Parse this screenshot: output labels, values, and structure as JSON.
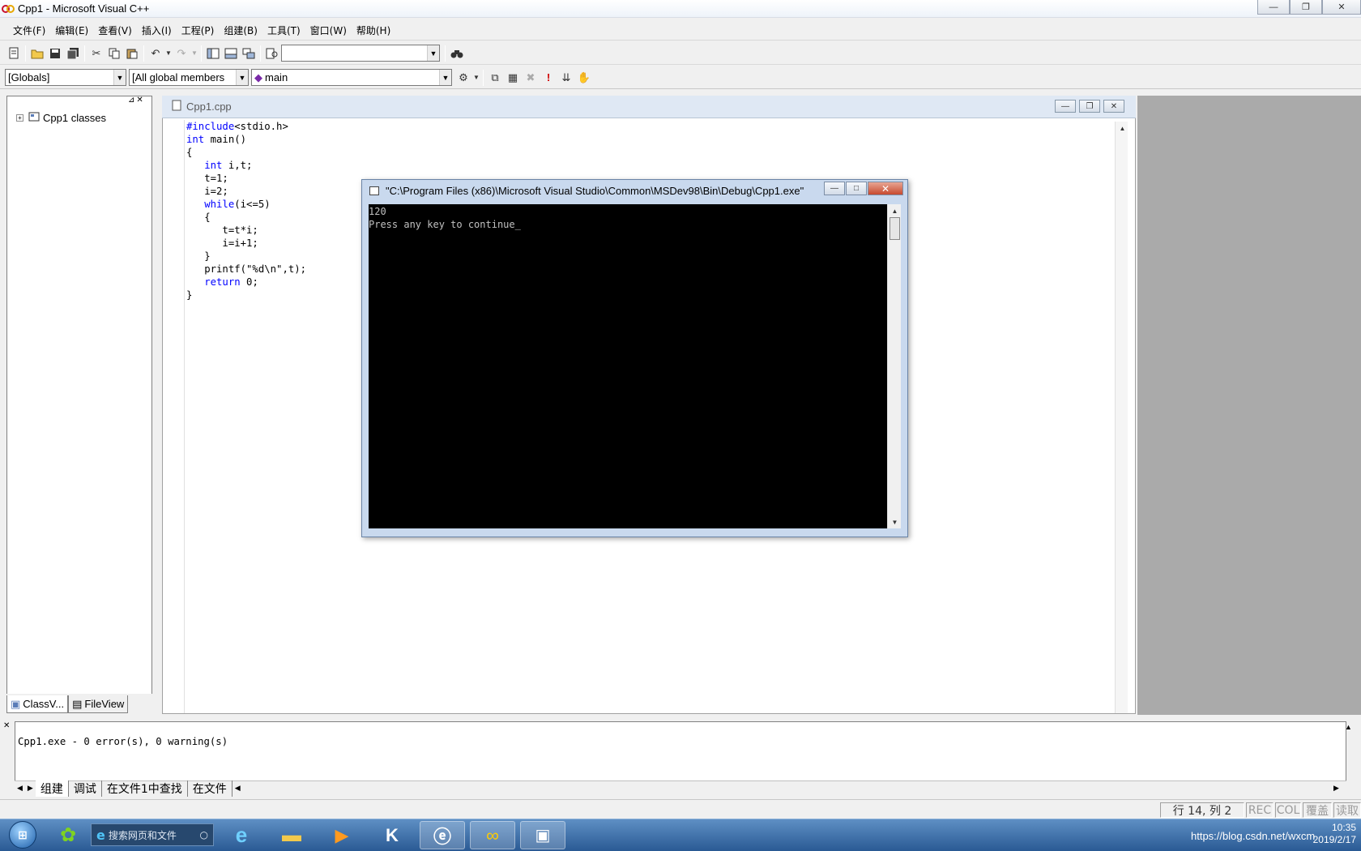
{
  "window": {
    "title": "Cpp1 - Microsoft Visual C++",
    "minimize": "—",
    "restore": "❐",
    "close": "✕"
  },
  "menu": [
    "文件(F)",
    "编辑(E)",
    "查看(V)",
    "插入(I)",
    "工程(P)",
    "组建(B)",
    "工具(T)",
    "窗口(W)",
    "帮助(H)"
  ],
  "toolbar2": {
    "scope": "[Globals]",
    "members": "[All global members",
    "function": "main"
  },
  "workspace": {
    "tree_root": "Cpp1 classes",
    "tabs": [
      "ClassV...",
      "FileView"
    ]
  },
  "editor": {
    "title": "Cpp1.cpp",
    "lines": [
      [
        {
          "t": "#include",
          "k": 1
        },
        {
          "t": "<stdio.h>",
          "k": 0
        }
      ],
      [
        {
          "t": "int",
          "k": 1
        },
        {
          "t": " main()",
          "k": 0
        }
      ],
      [
        {
          "t": "{",
          "k": 0
        }
      ],
      [
        {
          "t": "   ",
          "k": 0
        },
        {
          "t": "int",
          "k": 1
        },
        {
          "t": " i,t;",
          "k": 0
        }
      ],
      [
        {
          "t": "   t=1;",
          "k": 0
        }
      ],
      [
        {
          "t": "   i=2;",
          "k": 0
        }
      ],
      [
        {
          "t": "   ",
          "k": 0
        },
        {
          "t": "while",
          "k": 1
        },
        {
          "t": "(i<=5)",
          "k": 0
        }
      ],
      [
        {
          "t": "   {",
          "k": 0
        }
      ],
      [
        {
          "t": "      t=t*i;",
          "k": 0
        }
      ],
      [
        {
          "t": "      i=i+1;",
          "k": 0
        }
      ],
      [
        {
          "t": "   }",
          "k": 0
        }
      ],
      [
        {
          "t": "   printf(\"%d\\n\",t);",
          "k": 0
        }
      ],
      [
        {
          "t": "   ",
          "k": 0
        },
        {
          "t": "return",
          "k": 1
        },
        {
          "t": " 0;",
          "k": 0
        }
      ],
      [
        {
          "t": "}",
          "k": 0
        }
      ]
    ]
  },
  "console": {
    "title": "\"C:\\Program Files (x86)\\Microsoft Visual Studio\\Common\\MSDev98\\Bin\\Debug\\Cpp1.exe\"",
    "output_line1": "120",
    "output_line2": "Press any key to continue",
    "cursor": "_"
  },
  "output": {
    "message": "Cpp1.exe - 0 error(s), 0 warning(s)",
    "tabs": [
      "组建",
      "调试",
      "在文件1中查找",
      "在文件"
    ]
  },
  "status": {
    "position": "行 14, 列 2",
    "rec": "REC",
    "col": "COL",
    "ovr": "覆盖",
    "read": "读取"
  },
  "taskbar": {
    "search_placeholder": "搜索网页和文件",
    "tray_text": "https://blog.csdn.net/wxcm",
    "time": "10:35",
    "date": "2019/2/17"
  }
}
